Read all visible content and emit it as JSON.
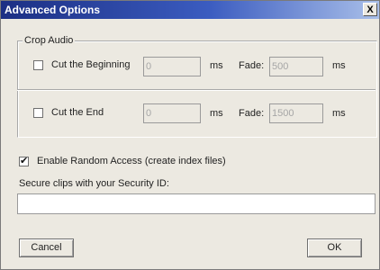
{
  "window": {
    "title": "Advanced Options",
    "close_label": "X"
  },
  "crop_audio": {
    "legend": "Crop Audio",
    "beginning": {
      "checkbox_label": "Cut the Beginning",
      "checked": false,
      "value": "0",
      "unit": "ms",
      "fade_label": "Fade:",
      "fade_value": "500",
      "fade_unit": "ms"
    },
    "end": {
      "checkbox_label": "Cut the End",
      "checked": false,
      "value": "0",
      "unit": "ms",
      "fade_label": "Fade:",
      "fade_value": "1500",
      "fade_unit": "ms"
    }
  },
  "random_access": {
    "label": "Enable Random Access (create index files)",
    "checked": true
  },
  "security": {
    "label": "Secure clips with your Security ID:",
    "value": ""
  },
  "buttons": {
    "cancel": "Cancel",
    "ok": "OK"
  }
}
